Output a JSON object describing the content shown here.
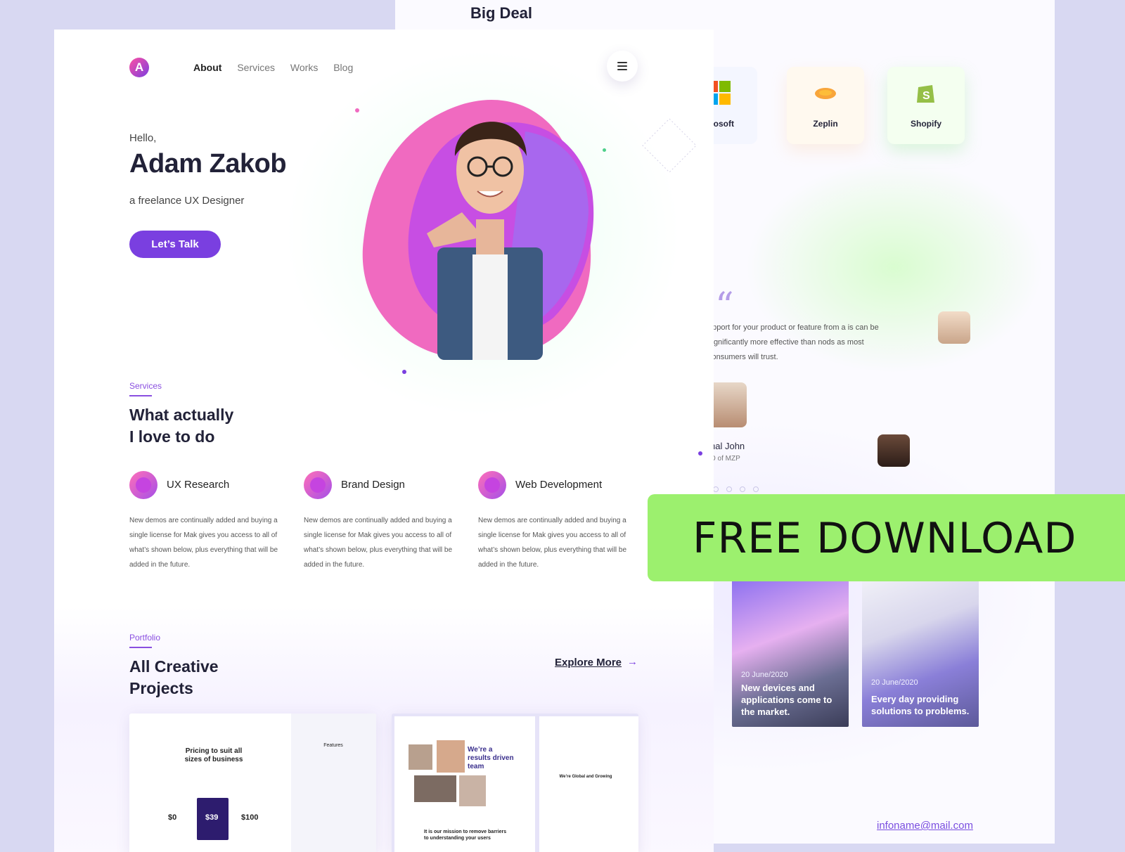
{
  "background_page": {
    "title": "Big Deal",
    "brands": [
      {
        "label": "icrosoft",
        "icon": "microsoft-logo-icon"
      },
      {
        "label": "Zeplin",
        "icon": "zeplin-logo-icon"
      },
      {
        "label": "Shopify",
        "icon": "shopify-logo-icon"
      }
    ],
    "testimonial": {
      "quote_icon": "quote-icon",
      "text": "upport for your product or feature from a is can be significantly more effective than nods as most consumers will trust.",
      "name": "hal John",
      "role": "O of MZP"
    },
    "blog": [
      {
        "date": "20 June/2020",
        "title": "New devices and applications come to the market."
      },
      {
        "date": "20 June/2020",
        "title": "Every day providing solutions to problems."
      }
    ],
    "email": "infoname@mail.com"
  },
  "main_page": {
    "logo": "A",
    "nav": [
      "About",
      "Services",
      "Works",
      "Blog"
    ],
    "menu_icon": "hamburger-icon",
    "hero": {
      "greeting": "Hello,",
      "name": "Adam Zakob",
      "subtitle": "a freelance UX Designer",
      "cta": "Let’s Talk"
    },
    "services": {
      "tag": "Services",
      "heading": "What  actually\nI love to do",
      "items": [
        {
          "title": "UX Research",
          "icon": "mobile-icon",
          "text": "New demos are continually added and buying a single license for Mak gives you access to all of what’s shown below, plus everything that will be added in the future."
        },
        {
          "title": "Brand Design",
          "icon": "brand-icon",
          "text": "New demos are continually added and buying a single license for Mak gives you access to all of what’s shown below, plus everything that will be added in the future."
        },
        {
          "title": "Web Development",
          "icon": "browser-icon",
          "text": "New demos are continually added and buying a single license for Mak gives you access to all of what’s shown below, plus everything that will be added in the future."
        }
      ]
    },
    "portfolio": {
      "tag": "Portfolio",
      "heading": "All Creative\nProjects",
      "explore": "Explore More",
      "thumb1": {
        "heading": "Pricing to suit all sizes of business",
        "prices": [
          "$0",
          "$39",
          "$100"
        ],
        "side_heading": "Features"
      },
      "thumb2": {
        "heading": "We’re a results driven team",
        "sub": "It is our mission to remove barriers to understanding your users",
        "side_heading": "We’re Global and Growing"
      }
    }
  },
  "banner": {
    "text": "FREE DOWNLOAD"
  },
  "colors": {
    "accent": "#7a3fe0",
    "banner": "#9cf06e",
    "backdrop": "#d8d8f2"
  }
}
